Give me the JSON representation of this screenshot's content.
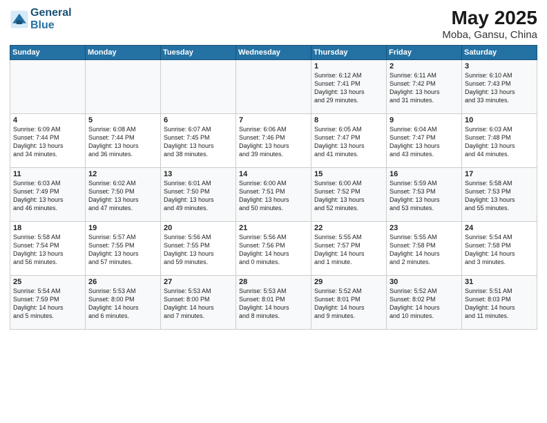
{
  "header": {
    "logo_line1": "General",
    "logo_line2": "Blue",
    "title": "May 2025",
    "subtitle": "Moba, Gansu, China"
  },
  "days_of_week": [
    "Sunday",
    "Monday",
    "Tuesday",
    "Wednesday",
    "Thursday",
    "Friday",
    "Saturday"
  ],
  "weeks": [
    [
      {
        "day": "",
        "content": ""
      },
      {
        "day": "",
        "content": ""
      },
      {
        "day": "",
        "content": ""
      },
      {
        "day": "",
        "content": ""
      },
      {
        "day": "1",
        "content": "Sunrise: 6:12 AM\nSunset: 7:41 PM\nDaylight: 13 hours\nand 29 minutes."
      },
      {
        "day": "2",
        "content": "Sunrise: 6:11 AM\nSunset: 7:42 PM\nDaylight: 13 hours\nand 31 minutes."
      },
      {
        "day": "3",
        "content": "Sunrise: 6:10 AM\nSunset: 7:43 PM\nDaylight: 13 hours\nand 33 minutes."
      }
    ],
    [
      {
        "day": "4",
        "content": "Sunrise: 6:09 AM\nSunset: 7:44 PM\nDaylight: 13 hours\nand 34 minutes."
      },
      {
        "day": "5",
        "content": "Sunrise: 6:08 AM\nSunset: 7:44 PM\nDaylight: 13 hours\nand 36 minutes."
      },
      {
        "day": "6",
        "content": "Sunrise: 6:07 AM\nSunset: 7:45 PM\nDaylight: 13 hours\nand 38 minutes."
      },
      {
        "day": "7",
        "content": "Sunrise: 6:06 AM\nSunset: 7:46 PM\nDaylight: 13 hours\nand 39 minutes."
      },
      {
        "day": "8",
        "content": "Sunrise: 6:05 AM\nSunset: 7:47 PM\nDaylight: 13 hours\nand 41 minutes."
      },
      {
        "day": "9",
        "content": "Sunrise: 6:04 AM\nSunset: 7:47 PM\nDaylight: 13 hours\nand 43 minutes."
      },
      {
        "day": "10",
        "content": "Sunrise: 6:03 AM\nSunset: 7:48 PM\nDaylight: 13 hours\nand 44 minutes."
      }
    ],
    [
      {
        "day": "11",
        "content": "Sunrise: 6:03 AM\nSunset: 7:49 PM\nDaylight: 13 hours\nand 46 minutes."
      },
      {
        "day": "12",
        "content": "Sunrise: 6:02 AM\nSunset: 7:50 PM\nDaylight: 13 hours\nand 47 minutes."
      },
      {
        "day": "13",
        "content": "Sunrise: 6:01 AM\nSunset: 7:50 PM\nDaylight: 13 hours\nand 49 minutes."
      },
      {
        "day": "14",
        "content": "Sunrise: 6:00 AM\nSunset: 7:51 PM\nDaylight: 13 hours\nand 50 minutes."
      },
      {
        "day": "15",
        "content": "Sunrise: 6:00 AM\nSunset: 7:52 PM\nDaylight: 13 hours\nand 52 minutes."
      },
      {
        "day": "16",
        "content": "Sunrise: 5:59 AM\nSunset: 7:53 PM\nDaylight: 13 hours\nand 53 minutes."
      },
      {
        "day": "17",
        "content": "Sunrise: 5:58 AM\nSunset: 7:53 PM\nDaylight: 13 hours\nand 55 minutes."
      }
    ],
    [
      {
        "day": "18",
        "content": "Sunrise: 5:58 AM\nSunset: 7:54 PM\nDaylight: 13 hours\nand 56 minutes."
      },
      {
        "day": "19",
        "content": "Sunrise: 5:57 AM\nSunset: 7:55 PM\nDaylight: 13 hours\nand 57 minutes."
      },
      {
        "day": "20",
        "content": "Sunrise: 5:56 AM\nSunset: 7:55 PM\nDaylight: 13 hours\nand 59 minutes."
      },
      {
        "day": "21",
        "content": "Sunrise: 5:56 AM\nSunset: 7:56 PM\nDaylight: 14 hours\nand 0 minutes."
      },
      {
        "day": "22",
        "content": "Sunrise: 5:55 AM\nSunset: 7:57 PM\nDaylight: 14 hours\nand 1 minute."
      },
      {
        "day": "23",
        "content": "Sunrise: 5:55 AM\nSunset: 7:58 PM\nDaylight: 14 hours\nand 2 minutes."
      },
      {
        "day": "24",
        "content": "Sunrise: 5:54 AM\nSunset: 7:58 PM\nDaylight: 14 hours\nand 3 minutes."
      }
    ],
    [
      {
        "day": "25",
        "content": "Sunrise: 5:54 AM\nSunset: 7:59 PM\nDaylight: 14 hours\nand 5 minutes."
      },
      {
        "day": "26",
        "content": "Sunrise: 5:53 AM\nSunset: 8:00 PM\nDaylight: 14 hours\nand 6 minutes."
      },
      {
        "day": "27",
        "content": "Sunrise: 5:53 AM\nSunset: 8:00 PM\nDaylight: 14 hours\nand 7 minutes."
      },
      {
        "day": "28",
        "content": "Sunrise: 5:53 AM\nSunset: 8:01 PM\nDaylight: 14 hours\nand 8 minutes."
      },
      {
        "day": "29",
        "content": "Sunrise: 5:52 AM\nSunset: 8:01 PM\nDaylight: 14 hours\nand 9 minutes."
      },
      {
        "day": "30",
        "content": "Sunrise: 5:52 AM\nSunset: 8:02 PM\nDaylight: 14 hours\nand 10 minutes."
      },
      {
        "day": "31",
        "content": "Sunrise: 5:51 AM\nSunset: 8:03 PM\nDaylight: 14 hours\nand 11 minutes."
      }
    ]
  ]
}
